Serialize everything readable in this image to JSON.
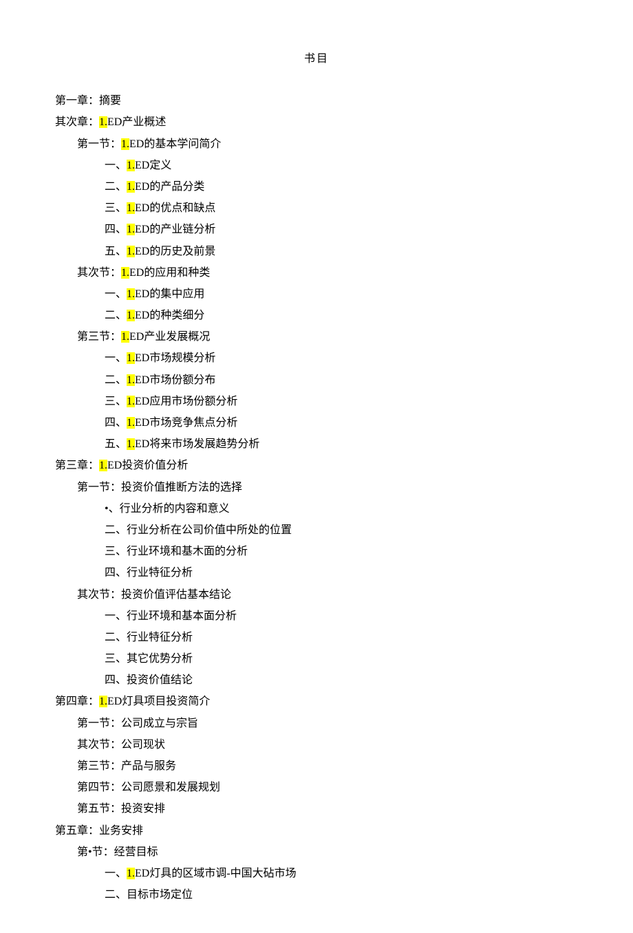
{
  "title": "书目",
  "lines": [
    {
      "level": 0,
      "prefix": "第一章：",
      "hl": "",
      "suffix": "摘要"
    },
    {
      "level": 0,
      "prefix": "其次章：",
      "hl": "1.",
      "suffix": "ED产业概述"
    },
    {
      "level": 1,
      "prefix": "第一节：",
      "hl": "1.",
      "suffix": "ED的基本学问简介"
    },
    {
      "level": 2,
      "prefix": "一、",
      "hl": "1.",
      "suffix": "ED定义"
    },
    {
      "level": 2,
      "prefix": "二、",
      "hl": "1.",
      "suffix": "ED的产品分类"
    },
    {
      "level": 2,
      "prefix": "三、",
      "hl": "1.",
      "suffix": "ED的优点和缺点"
    },
    {
      "level": 2,
      "prefix": "四、",
      "hl": "1.",
      "suffix": "ED的产业链分析"
    },
    {
      "level": 2,
      "prefix": "五、",
      "hl": "1.",
      "suffix": "ED的历史及前景"
    },
    {
      "level": 1,
      "prefix": "其次节：",
      "hl": "1.",
      "suffix": "ED的应用和种类"
    },
    {
      "level": 2,
      "prefix": "一、",
      "hl": "1.",
      "suffix": "ED的集中应用"
    },
    {
      "level": 2,
      "prefix": "二、",
      "hl": "1.",
      "suffix": "ED的种类细分"
    },
    {
      "level": 1,
      "prefix": "第三节：",
      "hl": "1.",
      "suffix": "ED产业发展概况"
    },
    {
      "level": 2,
      "prefix": "一、",
      "hl": "1.",
      "suffix": "ED市场规模分析"
    },
    {
      "level": 2,
      "prefix": "二、",
      "hl": "1.",
      "suffix": "ED市场份额分布"
    },
    {
      "level": 2,
      "prefix": "三、",
      "hl": "1.",
      "suffix": "ED应用市场份额分析"
    },
    {
      "level": 2,
      "prefix": "四、",
      "hl": "1.",
      "suffix": "ED市场竞争焦点分析"
    },
    {
      "level": 2,
      "prefix": "五、",
      "hl": "1.",
      "suffix": "ED将来市场发展趋势分析"
    },
    {
      "level": 0,
      "prefix": "第三章：",
      "hl": "1.",
      "suffix": "ED投资价值分析"
    },
    {
      "level": 1,
      "prefix": "第一节：",
      "hl": "",
      "suffix": "投资价值推断方法的选择"
    },
    {
      "level": 2,
      "prefix": "•、",
      "hl": "",
      "suffix": "行业分析的内容和意义"
    },
    {
      "level": 2,
      "prefix": "二、",
      "hl": "",
      "suffix": "行业分析在公司价值中所处的位置"
    },
    {
      "level": 2,
      "prefix": "三、",
      "hl": "",
      "suffix": "行业环境和基木面的分析"
    },
    {
      "level": 2,
      "prefix": "四、",
      "hl": "",
      "suffix": "行业特征分析"
    },
    {
      "level": 1,
      "prefix": "其次节：",
      "hl": "",
      "suffix": "投资价值评估基本结论"
    },
    {
      "level": 2,
      "prefix": "一、",
      "hl": "",
      "suffix": "行业环境和基本面分析"
    },
    {
      "level": 2,
      "prefix": "二、",
      "hl": "",
      "suffix": "行业特征分析"
    },
    {
      "level": 2,
      "prefix": "三、",
      "hl": "",
      "suffix": "其它优势分析"
    },
    {
      "level": 2,
      "prefix": "四、",
      "hl": "",
      "suffix": "投资价值结论"
    },
    {
      "level": 0,
      "prefix": "第四章：",
      "hl": "1.",
      "suffix": "ED灯具项目投资简介"
    },
    {
      "level": 1,
      "prefix": "第一节：",
      "hl": "",
      "suffix": "公司成立与宗旨"
    },
    {
      "level": 1,
      "prefix": "其次节：",
      "hl": "",
      "suffix": "公司现状"
    },
    {
      "level": 1,
      "prefix": "第三节：",
      "hl": "",
      "suffix": "产品与服务"
    },
    {
      "level": 1,
      "prefix": "第四节：",
      "hl": "",
      "suffix": "公司愿景和发展规划"
    },
    {
      "level": 1,
      "prefix": "第五节：",
      "hl": "",
      "suffix": "投资安排"
    },
    {
      "level": 0,
      "prefix": "第五章：",
      "hl": "",
      "suffix": "业务安排"
    },
    {
      "level": 1,
      "prefix": "第•节：",
      "hl": "",
      "suffix": "经营目标"
    },
    {
      "level": 2,
      "prefix": "一、",
      "hl": "1.",
      "suffix": "ED灯具的区域市调-中国大砧市场"
    },
    {
      "level": 2,
      "prefix": "二、",
      "hl": "",
      "suffix": "目标市场定位"
    }
  ]
}
